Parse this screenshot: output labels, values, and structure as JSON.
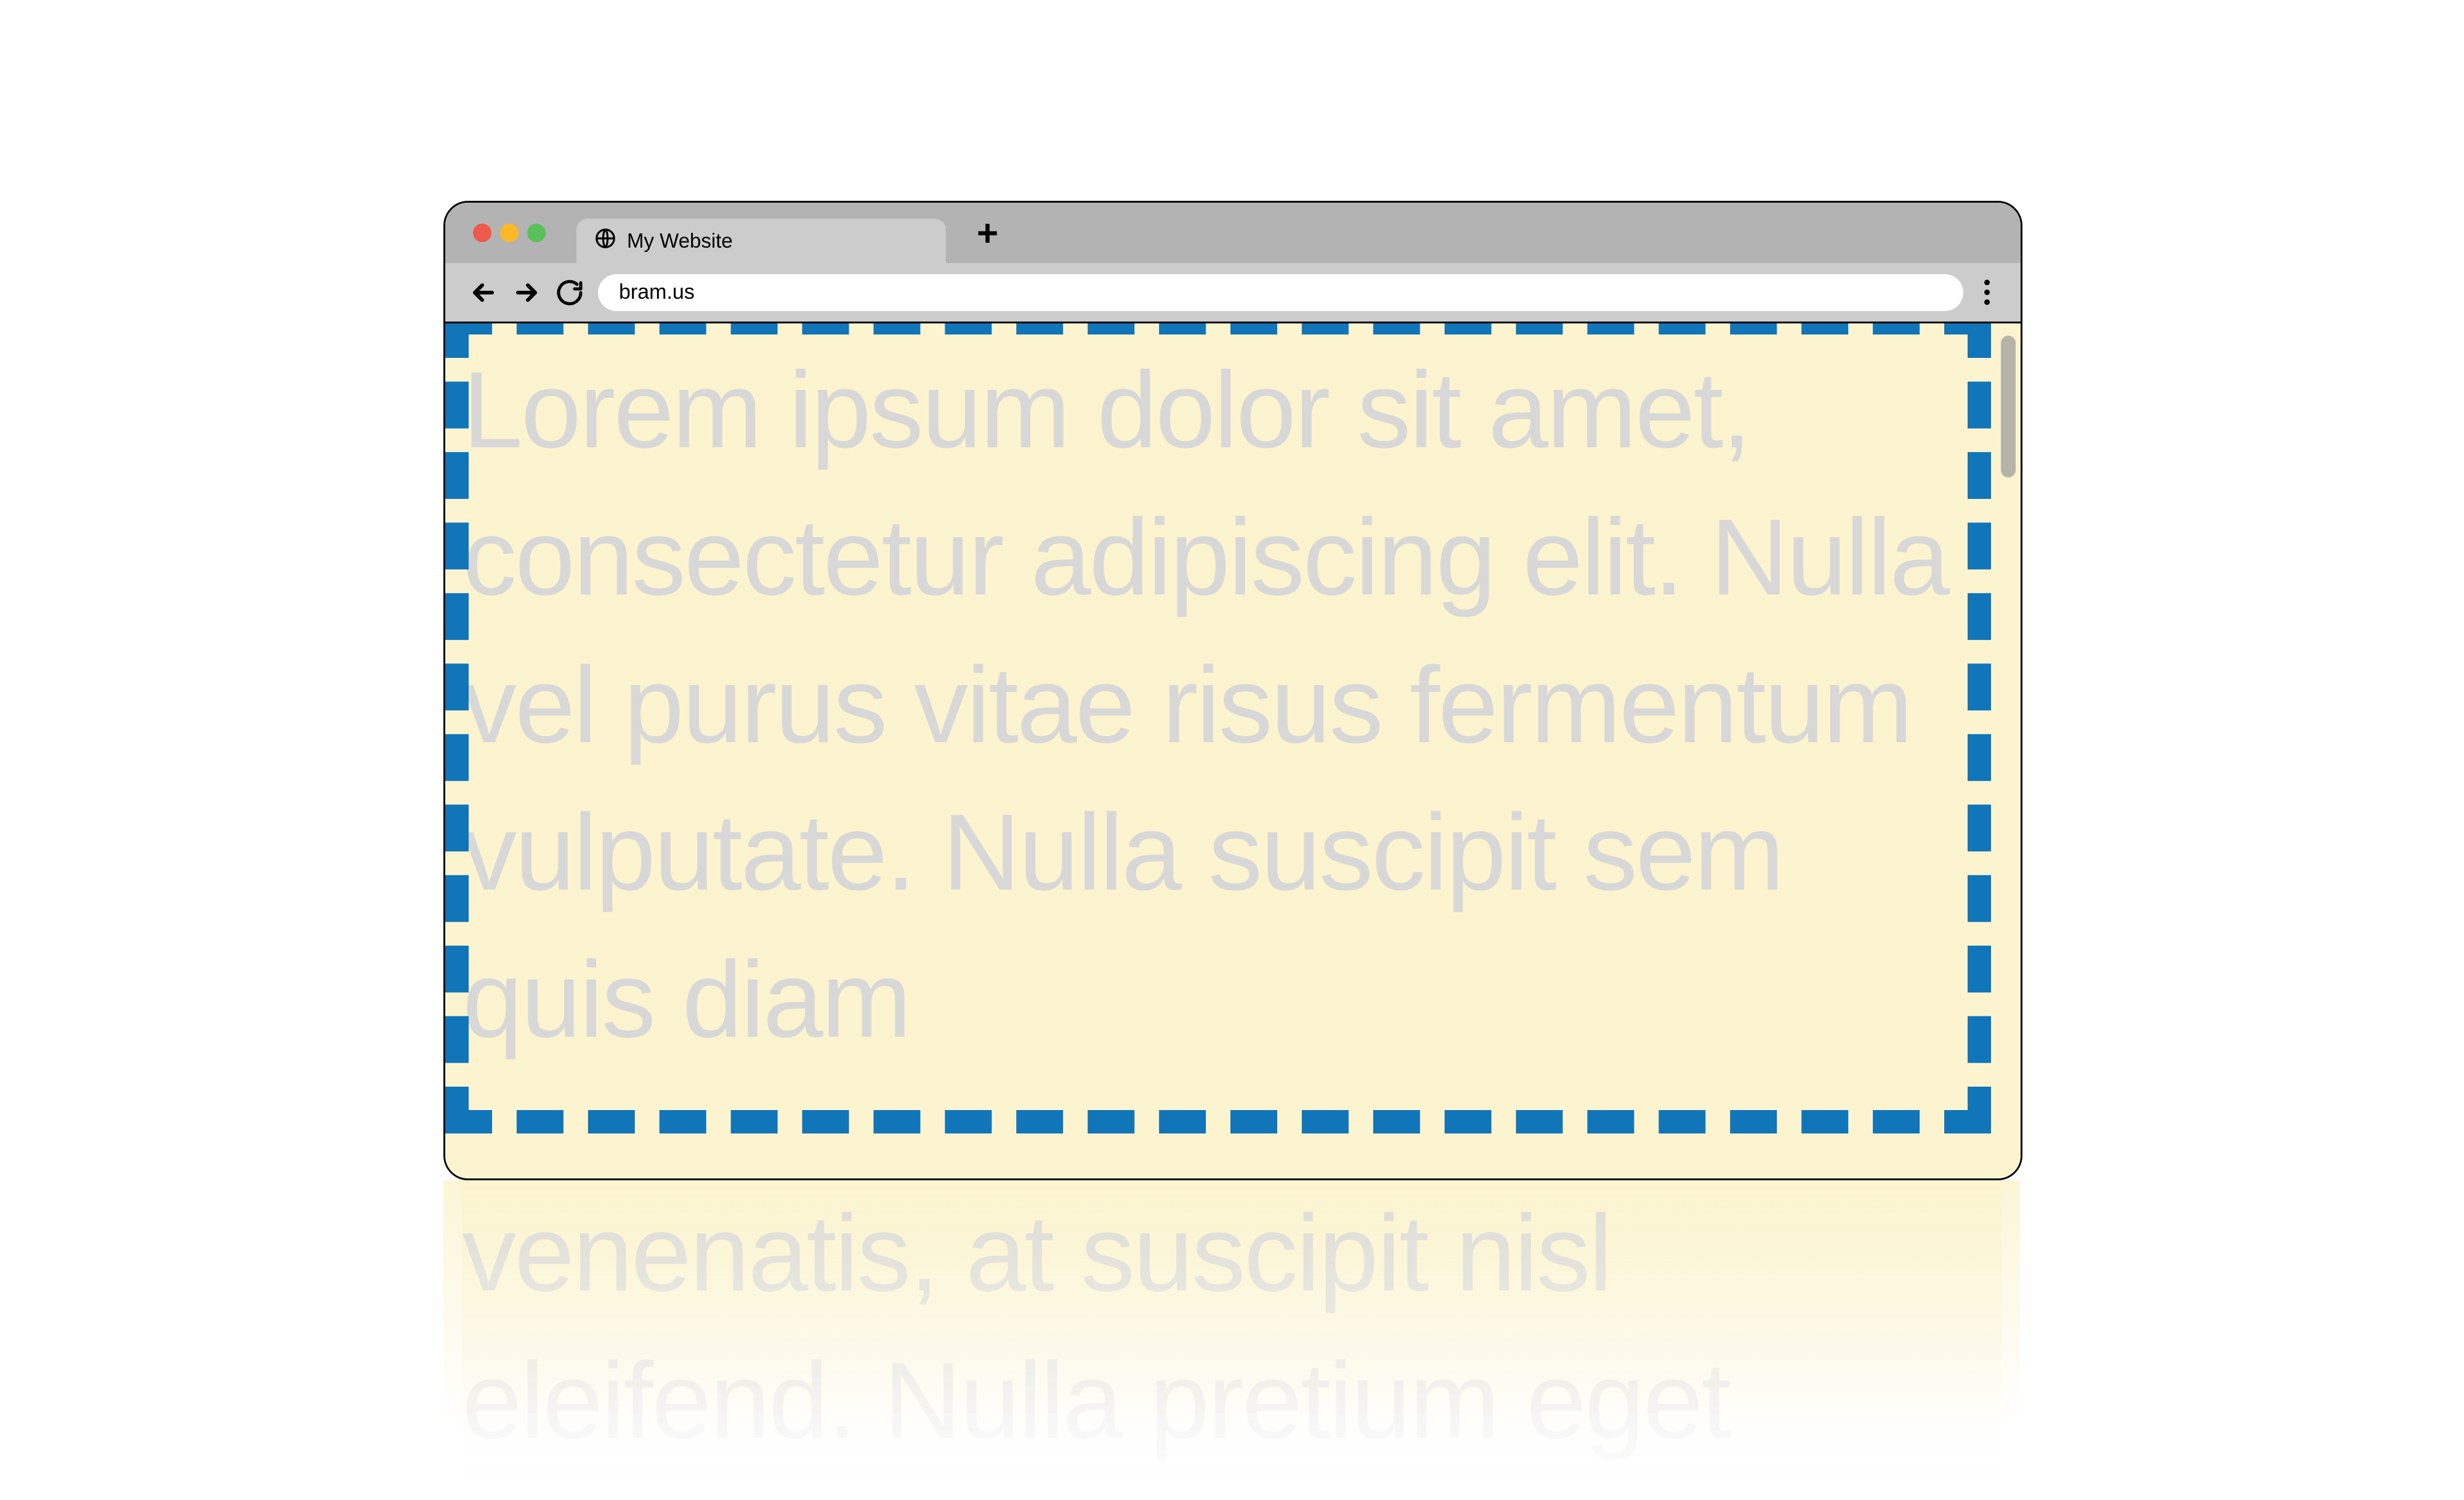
{
  "tab": {
    "title": "My Website"
  },
  "address": {
    "url": "bram.us"
  },
  "page": {
    "visible_text": "Lorem ipsum dolor sit amet, consectetur adipiscing elit. Nulla vel purus vitae risus fermentum vulputate. Nulla suscipit sem quis diam",
    "overflow_text": "venenatis, at suscipit nisl eleifend. Nulla pretium eget"
  },
  "colors": {
    "viewport_bg": "#fbf4cf",
    "dashed_border": "#1175b9",
    "body_text": "#d8d8d8"
  }
}
